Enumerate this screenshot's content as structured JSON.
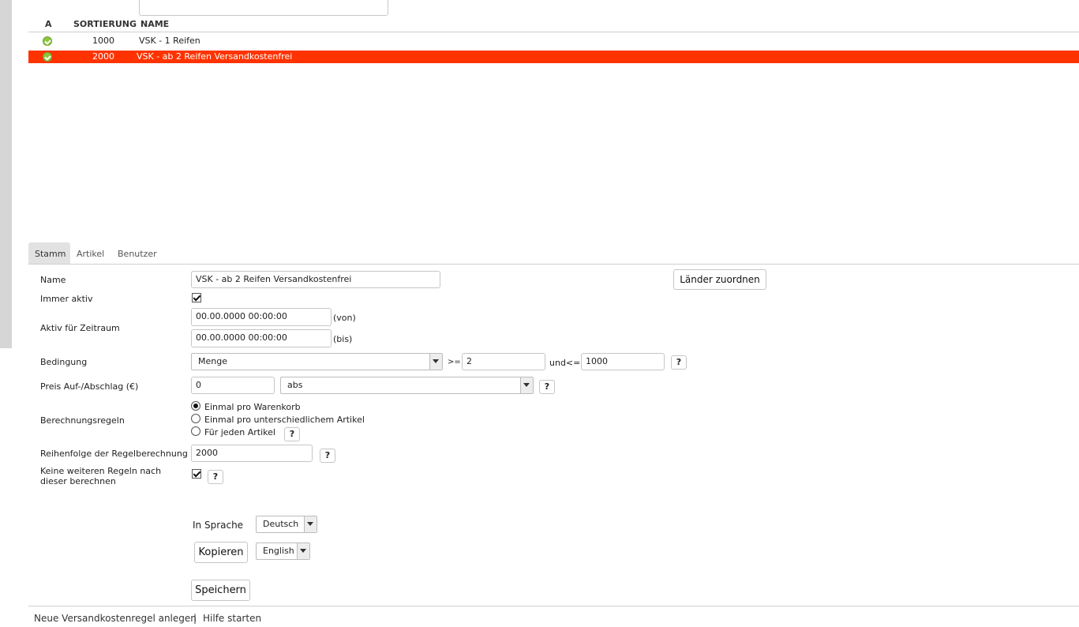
{
  "list": {
    "headers": {
      "active": "A",
      "sort": "SORTIERUNG",
      "name": "NAME"
    },
    "rows": [
      {
        "sort": "1000",
        "name": "VSK - 1 Reifen",
        "active_icon": "check-circle-icon",
        "selected": false
      },
      {
        "sort": "2000",
        "name": "VSK - ab 2 Reifen Versandkostenfrei",
        "active_icon": "check-circle-icon",
        "selected": true
      }
    ],
    "selected_color": "#ff3300"
  },
  "tabs": [
    "Stamm",
    "Artikel",
    "Benutzer"
  ],
  "form": {
    "name_label": "Name",
    "name_value": "VSK - ab 2 Reifen Versandkostenfrei",
    "countries_button": "Länder zuordnen",
    "always_active_label": "Immer aktiv",
    "always_active_checked": true,
    "period_label": "Aktiv für Zeitraum",
    "period_from": "00.00.0000 00:00:00",
    "period_from_suffix": "(von)",
    "period_to": "00.00.0000 00:00:00",
    "period_to_suffix": "(bis)",
    "condition_label": "Bedingung",
    "condition_select": "Menge",
    "condition_gte_label": ">=",
    "condition_gte_value": "2",
    "condition_lte_label": "und<=",
    "condition_lte_value": "1000",
    "price_label": "Preis Auf-/Abschlag (€)",
    "price_value": "0",
    "price_mode": "abs",
    "calc_rules_label": "Berechnungsregeln",
    "calc_rules_options": [
      "Einmal pro Warenkorb",
      "Einmal pro unterschiedlichem Artikel",
      "Für jeden Artikel"
    ],
    "calc_rules_selected": 0,
    "order_label": "Reihenfolge der Regelberechnung",
    "order_value": "2000",
    "no_further_label": "Keine weiteren Regeln nach dieser berechnen",
    "no_further_checked": true,
    "help_symbol": "?",
    "language_label": "In Sprache",
    "language_value": "Deutsch",
    "copy_button": "Kopieren",
    "copy_language": "English",
    "save_button": "Speichern"
  },
  "footer": {
    "new_rule_link": "Neue Versandkostenregel anlegen",
    "separator": "|",
    "help_link": "Hilfe starten"
  }
}
